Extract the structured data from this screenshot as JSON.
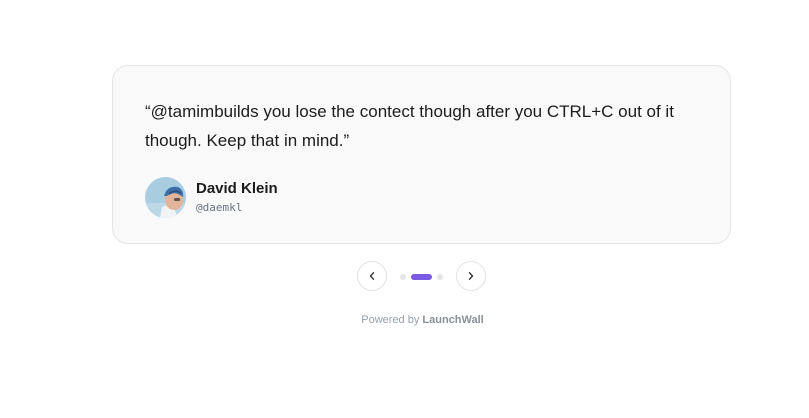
{
  "testimonial": {
    "quote": "“@tamimbuilds you lose the contect though after you CTRL+C out of it though. Keep that in mind.”",
    "author_name": "David Klein",
    "author_handle": "@daemkl",
    "avatar_icon": "avatar-image"
  },
  "carousel": {
    "prev_icon": "chevron-left-icon",
    "next_icon": "chevron-right-icon",
    "total_slides": 3,
    "active_slide": 2,
    "active_color": "#7b5ae4",
    "inactive_color": "#e5e5e5"
  },
  "footer": {
    "powered_prefix": "Powered by",
    "brand": "LaunchWall"
  }
}
